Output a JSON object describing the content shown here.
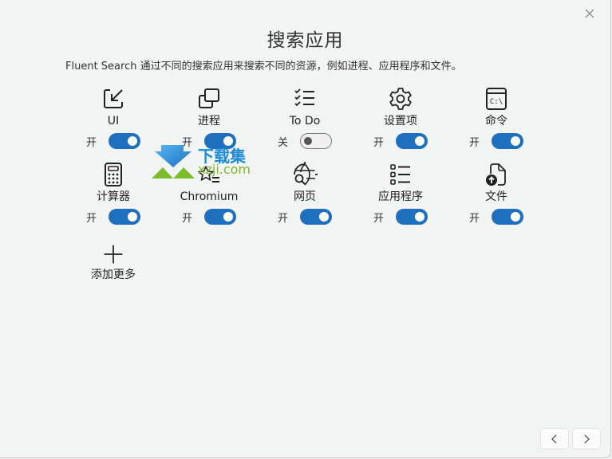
{
  "window": {
    "title": "搜索应用",
    "description": "Fluent Search 通过不同的搜索应用来搜索不同的资源，例如进程、应用程序和文件。",
    "close_icon": "close-icon"
  },
  "apps": [
    {
      "label": "UI",
      "icon": "ui-pointer-icon",
      "state_label": "开",
      "enabled": true
    },
    {
      "label": "进程",
      "icon": "process-windows-icon",
      "state_label": "开",
      "enabled": true
    },
    {
      "label": "To Do",
      "icon": "todo-checklist-icon",
      "state_label": "关",
      "enabled": false
    },
    {
      "label": "设置项",
      "icon": "gear-icon",
      "state_label": "开",
      "enabled": true
    },
    {
      "label": "命令",
      "icon": "command-prompt-icon",
      "state_label": "开",
      "enabled": true
    },
    {
      "label": "计算器",
      "icon": "calculator-icon",
      "state_label": "开",
      "enabled": true
    },
    {
      "label": "Chromium",
      "icon": "star-list-icon",
      "state_label": "开",
      "enabled": true
    },
    {
      "label": "网页",
      "icon": "globe-search-icon",
      "state_label": "开",
      "enabled": true
    },
    {
      "label": "应用程序",
      "icon": "app-list-icon",
      "state_label": "开",
      "enabled": true
    },
    {
      "label": "文件",
      "icon": "file-upload-icon",
      "state_label": "开",
      "enabled": true
    }
  ],
  "add_more": {
    "label": "添加更多",
    "icon": "plus-icon"
  },
  "navigation": {
    "prev_icon": "chevron-left-icon",
    "next_icon": "chevron-right-icon"
  },
  "watermark": {
    "text": "下载集",
    "url": "xzji.com"
  },
  "colors": {
    "accent": "#1f6fbf",
    "background": "#f2f3f3"
  }
}
